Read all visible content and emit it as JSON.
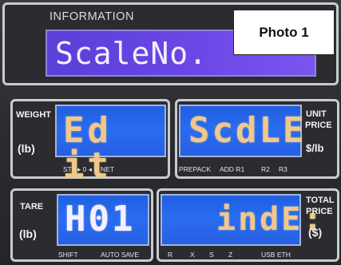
{
  "info": {
    "title": "INFORMATION",
    "display_text": "ScaleNo."
  },
  "photo_badge": "Photo 1",
  "weight": {
    "label": "WEIGHT",
    "unit": "(lb)",
    "display": "Ed it",
    "indicators": [
      "ST",
      "▸ 0 ◂",
      "NET"
    ]
  },
  "unit_price": {
    "label_line1": "UNIT",
    "label_line2": "PRICE",
    "unit": "$/lb",
    "display": "ScdLE",
    "indicators": [
      "PREPACK",
      "ADD R1",
      "R2",
      "R3"
    ]
  },
  "tare": {
    "label": "TARE",
    "unit": "(lb)",
    "display": "H01",
    "indicators": [
      "SHIFT",
      "AUTO SAVE"
    ]
  },
  "total_price": {
    "label_line1": "TOTAL",
    "label_line2": "PRICE",
    "unit": "($)",
    "display": "indE:",
    "indicators": [
      "R",
      "X",
      "S",
      "Z",
      "USB ETH"
    ]
  },
  "colors": {
    "lcd_blue": "#2a6cf0",
    "info_lcd_purple": "#6b47e6",
    "segment_amber": "#f1c88a",
    "frame": "#c8ccd2"
  }
}
